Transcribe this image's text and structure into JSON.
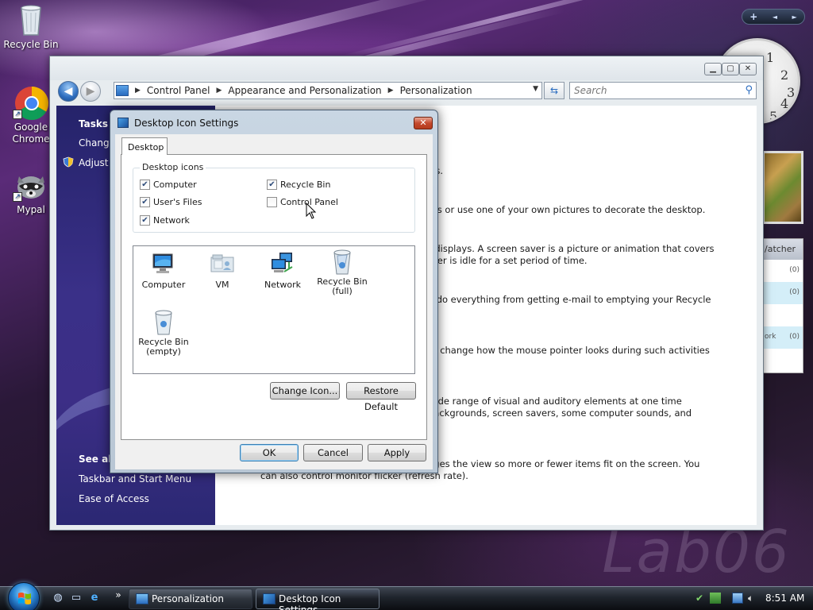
{
  "desktop": {
    "icons": [
      {
        "label": "Recycle Bin"
      },
      {
        "label": "Google\nChrome"
      },
      {
        "label": "Mypal"
      }
    ],
    "gadget_bar": {
      "add": "+",
      "prev": "◄",
      "next": "►"
    },
    "clock_numerals": [
      "1",
      "2",
      "3",
      "4",
      "5"
    ],
    "feed_gadget": {
      "title": "/atcher",
      "rows": [
        "(0)",
        "(0)",
        "(0)"
      ],
      "row_label": "ork"
    },
    "watermark": "Lab06"
  },
  "personalization_window": {
    "address": {
      "crumbs": [
        "Control Panel",
        "Appearance and Personalization",
        "Personalization"
      ]
    },
    "search_placeholder": "Search",
    "left_pane": {
      "tasks_heading": "Tasks",
      "task_items": [
        "Change",
        "Adjust f"
      ],
      "see_also_heading": "See als",
      "see_also_items": [
        "Taskbar and Start Menu",
        "Ease of Access"
      ]
    },
    "content_lines": [
      "ws.",
      "ors or use one of your own pictures to decorate the desktop.",
      "r displays. A screen saver is a picture or animation that covers",
      "uter is idle for a set period of time.",
      "o do everything from getting e-mail to emptying your Recycle",
      "to change how the mouse pointer looks during such activities",
      "wide range of visual and auditory elements at one time",
      "backgrounds, screen savers, some computer sounds, and",
      "nges the view so more or fewer items fit on the screen. You",
      "can also control monitor flicker (refresh rate)."
    ]
  },
  "dialog": {
    "title": "Desktop Icon Settings",
    "tab": "Desktop",
    "group_title": "Desktop icons",
    "checkboxes": [
      {
        "label": "Computer",
        "checked": true
      },
      {
        "label": "User's Files",
        "checked": true
      },
      {
        "label": "Network",
        "checked": true
      },
      {
        "label": "Recycle Bin",
        "checked": true
      },
      {
        "label": "Control Panel",
        "checked": false
      }
    ],
    "icons": [
      {
        "label": "Computer",
        "icon": "computer-icon"
      },
      {
        "label": "VM",
        "icon": "user-files-icon"
      },
      {
        "label": "Network",
        "icon": "network-icon"
      },
      {
        "label": "Recycle Bin\n(full)",
        "icon": "recycle-bin-full-icon"
      },
      {
        "label": "Recycle Bin\n(empty)",
        "icon": "recycle-bin-empty-icon"
      }
    ],
    "change_icon_button": "Change Icon...",
    "restore_default_button": "Restore Default",
    "ok_button": "OK",
    "cancel_button": "Cancel",
    "apply_button": "Apply"
  },
  "taskbar": {
    "buttons": [
      {
        "label": "Personalization",
        "icon": "control-panel-icon",
        "active": false
      },
      {
        "label": "Desktop Icon Settings",
        "icon": "desktop-icon-settings-icon",
        "active": true
      }
    ],
    "overflow": "»",
    "time": "8:51 AM"
  }
}
